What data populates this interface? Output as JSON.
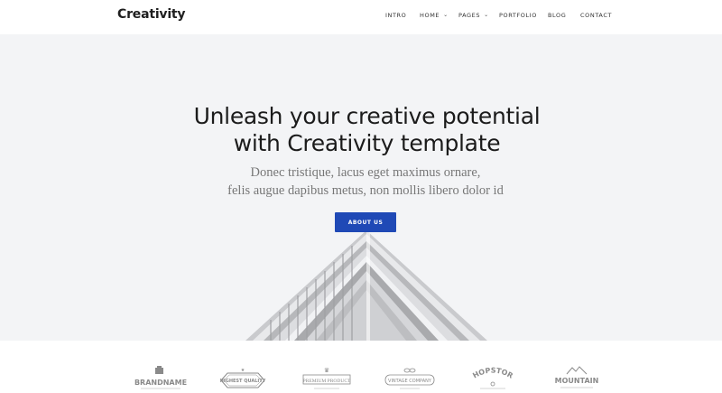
{
  "brand": {
    "name": "Creativity"
  },
  "nav": {
    "items": [
      {
        "label": "INTRO",
        "dropdown": false
      },
      {
        "label": "HOME",
        "dropdown": true
      },
      {
        "label": "PAGES",
        "dropdown": true
      },
      {
        "label": "PORTFOLIO",
        "dropdown": false
      },
      {
        "label": "BLOG",
        "dropdown": false
      },
      {
        "label": "CONTACT",
        "dropdown": false
      }
    ]
  },
  "hero": {
    "title_line1": "Unleash your creative potential",
    "title_line2": "with Creativity template",
    "subtitle_line1": "Donec tristique, lacus eget maximus ornare,",
    "subtitle_line2": "felis augue dapibus metus, non mollis libero dolor id",
    "cta_label": "ABOUT US",
    "background_image": "building-roof-architecture"
  },
  "clients": {
    "logos": [
      {
        "name": "BRANDNAME",
        "tagline": ""
      },
      {
        "name": "HIGHEST QUALITY",
        "tagline": ""
      },
      {
        "name": "PREMIUM PRODUCT",
        "tagline": ""
      },
      {
        "name": "VINTAGE COMPANY",
        "tagline": ""
      },
      {
        "name": "SHOPSTORE",
        "tagline": ""
      },
      {
        "name": "MOUNTAIN",
        "tagline": ""
      }
    ]
  },
  "colors": {
    "accent": "#1f49b6",
    "hero_bg": "#f3f4f6",
    "text_dark": "#1b1b1b",
    "text_muted": "#777777",
    "logo_gray": "#8a8a8a"
  }
}
